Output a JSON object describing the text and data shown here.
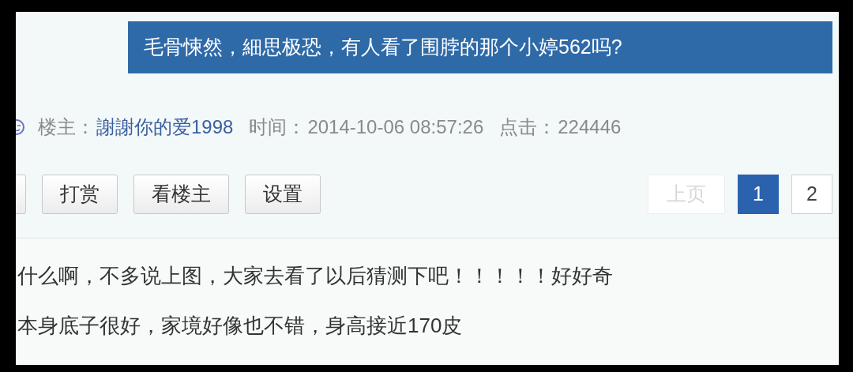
{
  "thread_title": "毛骨悚然，細思极恐，有人看了围脖的那个小婷562吗?",
  "meta": {
    "author_label": "楼主：",
    "author": "謝謝你的爱1998",
    "time_label": "时间：",
    "time": "2014-10-06 08:57:26",
    "clicks_label": "点击：",
    "clicks": "224446"
  },
  "buttons": [
    "打赏",
    "看楼主",
    "设置"
  ],
  "pagination": [
    {
      "label": "上页",
      "kind": "prev",
      "disabled": true,
      "selected": false
    },
    {
      "label": "1",
      "kind": "page",
      "disabled": false,
      "selected": true
    },
    {
      "label": "2",
      "kind": "page",
      "disabled": false,
      "selected": false
    }
  ],
  "post_lines": [
    "什么啊，不多说上图，大家去看了以后猜测下吧！！！！！好好奇",
    "本身底子很好，家境好像也不错，身高接近170皮"
  ]
}
